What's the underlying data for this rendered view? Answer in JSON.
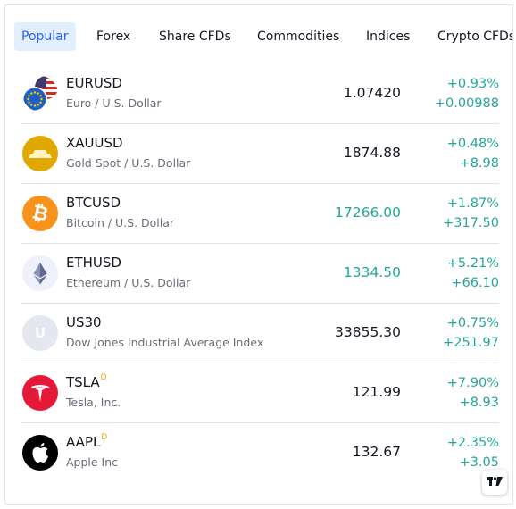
{
  "tabs": [
    {
      "label": "Popular",
      "active": true
    },
    {
      "label": "Forex",
      "active": false
    },
    {
      "label": "Share CFDs",
      "active": false
    },
    {
      "label": "Commodities",
      "active": false
    },
    {
      "label": "Indices",
      "active": false
    },
    {
      "label": "Crypto CFDs",
      "active": false
    }
  ],
  "rows": [
    {
      "symbol": "EURUSD",
      "description": "Euro / U.S. Dollar",
      "price": "1.07420",
      "price_up": false,
      "change_pct": "+0.93%",
      "change_abs": "+0.00988",
      "icon": "eu-us-flag-icon"
    },
    {
      "symbol": "XAUUSD",
      "description": "Gold Spot / U.S. Dollar",
      "price": "1874.88",
      "price_up": false,
      "change_pct": "+0.48%",
      "change_abs": "+8.98",
      "icon": "gold-bars-icon"
    },
    {
      "symbol": "BTCUSD",
      "description": "Bitcoin / U.S. Dollar",
      "price": "17266.00",
      "price_up": true,
      "change_pct": "+1.87%",
      "change_abs": "+317.50",
      "icon": "bitcoin-icon"
    },
    {
      "symbol": "ETHUSD",
      "description": "Ethereum / U.S. Dollar",
      "price": "1334.50",
      "price_up": true,
      "change_pct": "+5.21%",
      "change_abs": "+66.10",
      "icon": "ethereum-icon"
    },
    {
      "symbol": "US30",
      "description": "Dow Jones Industrial Average Index",
      "price": "33855.30",
      "price_up": false,
      "change_pct": "+0.75%",
      "change_abs": "+251.97",
      "icon": "us30-letter-icon",
      "letter": "U"
    },
    {
      "symbol": "TSLA",
      "sup": "D",
      "description": "Tesla, Inc.",
      "price": "121.99",
      "price_up": false,
      "change_pct": "+7.90%",
      "change_abs": "+8.93",
      "icon": "tesla-icon"
    },
    {
      "symbol": "AAPL",
      "sup": "D",
      "description": "Apple Inc",
      "price": "132.67",
      "price_up": false,
      "change_pct": "+2.35%",
      "change_abs": "+3.05",
      "icon": "apple-icon"
    }
  ],
  "colors": {
    "positive": "#26a69a",
    "active_tab_bg": "#e3effd",
    "active_tab_text": "#2962ff"
  }
}
